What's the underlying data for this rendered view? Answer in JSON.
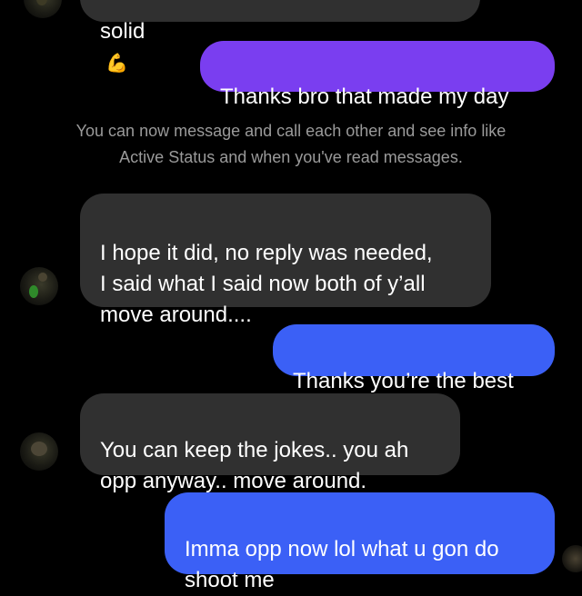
{
  "messages": {
    "top_incoming_partial": "solid",
    "top_reaction_icon": "flexed-biceps-emoji",
    "thanks_bro": "Thanks bro that made my day",
    "system_note": "You can now message and call each other and see info like\nActive Status and when you've read messages.",
    "hope_it_did": "I hope it did, no reply was needed,\nI said what I said now both of y’all\nmove around....",
    "thanks_best": "Thanks you’re the best",
    "keep_jokes": "You can keep the jokes.. you ah\nopp anyway.. move around.",
    "imma_opp": "Imma opp now lol what u gon do\nshoot me"
  },
  "colors": {
    "background": "#000000",
    "incoming_bubble": "#303030",
    "outgoing_purple": "#7a3ef0",
    "outgoing_blue": "#3b60f6",
    "system_text": "#9a9a9a"
  }
}
